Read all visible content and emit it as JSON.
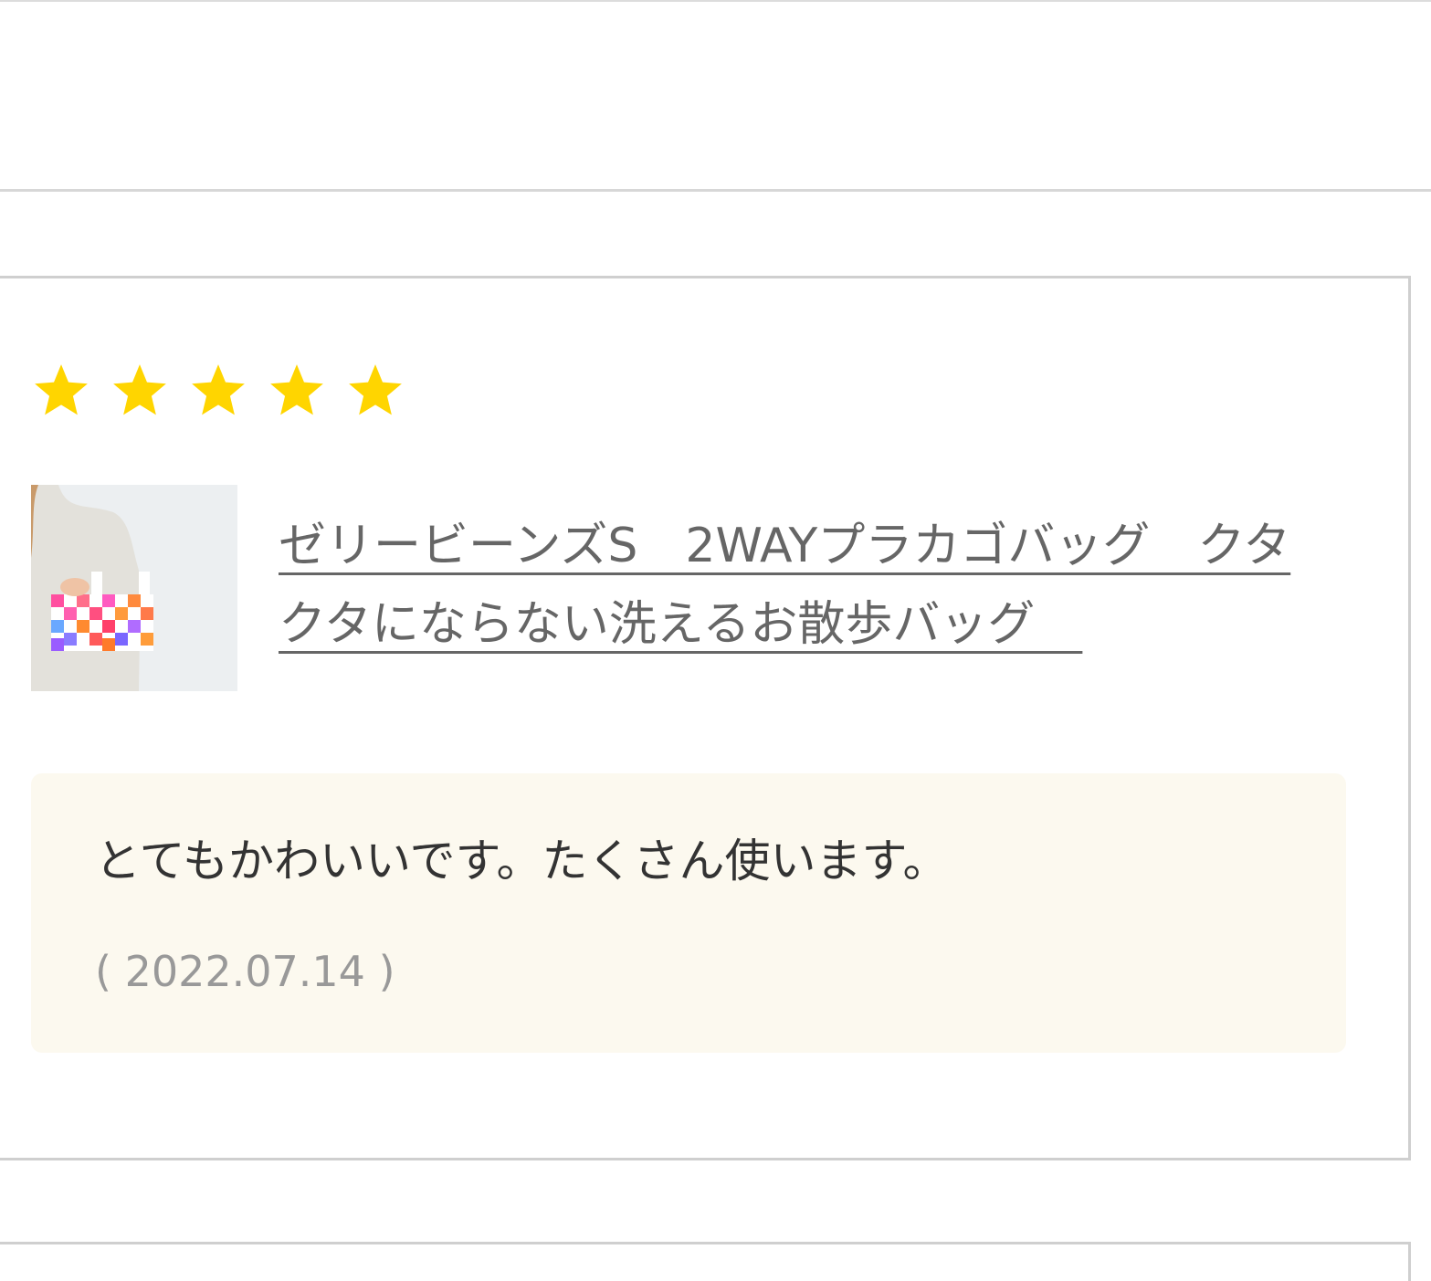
{
  "review": {
    "rating": 5,
    "rating_max": 5,
    "star_color": "#ffd500",
    "product_title": "ゼリービーンズS　2WAYプラカゴバッグ　クタクタにならない洗えるお散歩バッグ　",
    "comment": "とてもかわいいです。たくさん使います。",
    "date": "( 2022.07.14 )"
  },
  "icons": {
    "star": "star-icon",
    "thumbnail": "product-thumbnail"
  },
  "colors": {
    "comment_bg": "#fcf9ef",
    "link_text": "#666666",
    "border": "#cfcfcf"
  }
}
